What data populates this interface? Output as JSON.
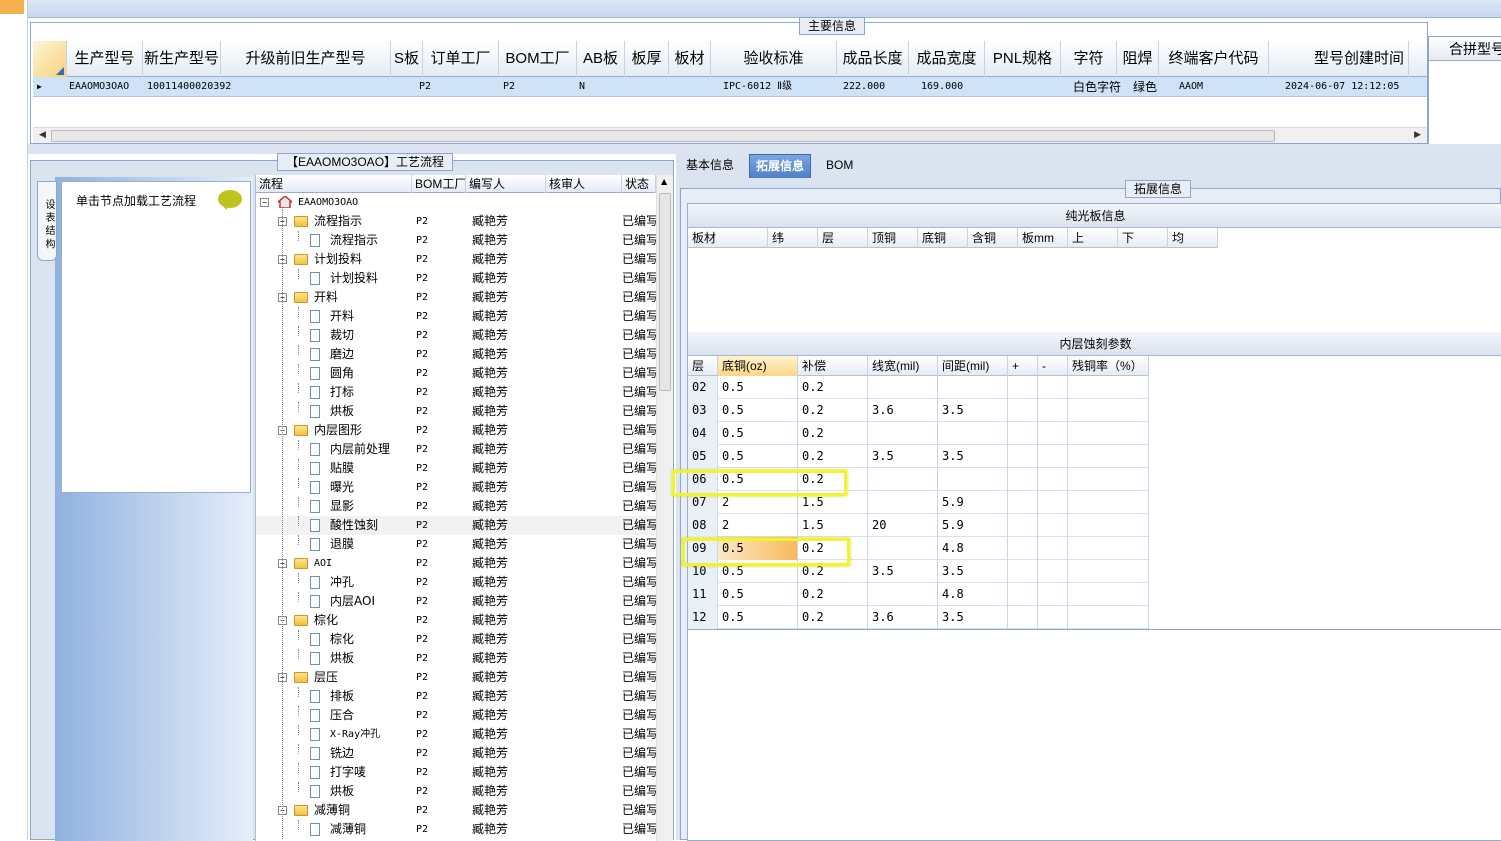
{
  "main_info": {
    "title": "主要信息",
    "columns": [
      "生产型号",
      "新生产型号",
      "升级前旧生产型号",
      "S板",
      "订单工厂",
      "BOM工厂",
      "AB板",
      "板厚",
      "板材",
      "验收标准",
      "成品长度",
      "成品宽度",
      "PNL规格",
      "字符",
      "阻焊",
      "终端客户代码",
      "型号创建时间"
    ],
    "row": {
      "model": "EAAOMO3OAO",
      "new_model": "10011400020392",
      "old_model": "",
      "s_board": "",
      "order_factory": "P2",
      "bom_factory": "P2",
      "ab_board": "N",
      "thickness": "",
      "material": "",
      "standard": "IPC-6012 Ⅱ级",
      "length": "222.000",
      "width": "169.000",
      "pnl": "",
      "char": "白色字符",
      "solder": "绿色",
      "customer": "AAOM",
      "created": "2024-06-07 12:12:05"
    },
    "merge_header": "合拼型号"
  },
  "flow": {
    "title": "【EAAOMO3OAO】工艺流程",
    "vertical_tab": "设 表 结 构",
    "hint": "单击节点加载工艺流程",
    "columns": [
      "流程",
      "BOM工厂",
      "编写人",
      "核审人",
      "状态"
    ],
    "root": "EAAOMO3OAO",
    "nodes": [
      {
        "label": "流程指示",
        "type": "folder",
        "level": 1
      },
      {
        "label": "流程指示",
        "type": "doc",
        "level": 2
      },
      {
        "label": "计划投料",
        "type": "folder",
        "level": 1
      },
      {
        "label": "计划投料",
        "type": "doc",
        "level": 2
      },
      {
        "label": "开料",
        "type": "folder",
        "level": 1
      },
      {
        "label": "开料",
        "type": "doc",
        "level": 2
      },
      {
        "label": "裁切",
        "type": "doc",
        "level": 2
      },
      {
        "label": "磨边",
        "type": "doc",
        "level": 2
      },
      {
        "label": "圆角",
        "type": "doc",
        "level": 2
      },
      {
        "label": "打标",
        "type": "doc",
        "level": 2
      },
      {
        "label": "烘板",
        "type": "doc",
        "level": 2
      },
      {
        "label": "内层图形",
        "type": "folder",
        "level": 1
      },
      {
        "label": "内层前处理",
        "type": "doc",
        "level": 2
      },
      {
        "label": "贴膜",
        "type": "doc",
        "level": 2
      },
      {
        "label": "曝光",
        "type": "doc",
        "level": 2
      },
      {
        "label": "显影",
        "type": "doc",
        "level": 2
      },
      {
        "label": "酸性蚀刻",
        "type": "doc",
        "level": 2,
        "selected": true
      },
      {
        "label": "退膜",
        "type": "doc",
        "level": 2
      },
      {
        "label": "AOI",
        "type": "folder",
        "level": 1
      },
      {
        "label": "冲孔",
        "type": "doc",
        "level": 2
      },
      {
        "label": "内层AOI",
        "type": "doc",
        "level": 2
      },
      {
        "label": "棕化",
        "type": "folder",
        "level": 1
      },
      {
        "label": "棕化",
        "type": "doc",
        "level": 2
      },
      {
        "label": "烘板",
        "type": "doc",
        "level": 2
      },
      {
        "label": "层压",
        "type": "folder",
        "level": 1
      },
      {
        "label": "排板",
        "type": "doc",
        "level": 2
      },
      {
        "label": "压合",
        "type": "doc",
        "level": 2
      },
      {
        "label": "X-Ray冲孔",
        "type": "doc",
        "level": 2
      },
      {
        "label": "铣边",
        "type": "doc",
        "level": 2
      },
      {
        "label": "打字唛",
        "type": "doc",
        "level": 2
      },
      {
        "label": "烘板",
        "type": "doc",
        "level": 2
      },
      {
        "label": "减薄铜",
        "type": "folder",
        "level": 1
      },
      {
        "label": "减薄铜",
        "type": "doc",
        "level": 2
      }
    ],
    "bom_factory": "P2",
    "writer": "臧艳芳",
    "status": "已编写"
  },
  "tabs": [
    "基本信息",
    "拓展信息",
    "BOM"
  ],
  "active_tab": 1,
  "ext": {
    "title": "拓展信息",
    "plain_board": {
      "title": "纯光板信息",
      "columns": [
        "板材",
        "纬",
        "层",
        "顶铜",
        "底铜",
        "含铜",
        "板mm",
        "上",
        "下",
        "均"
      ]
    },
    "inner_etch": {
      "title": "内层蚀刻参数",
      "columns": [
        "层",
        "底铜(oz)",
        "补偿",
        "线宽(mil)",
        "间距(mil)",
        "+",
        "-",
        "残铜率（%）"
      ],
      "rows": [
        [
          "02",
          "0.5",
          "0.2",
          "",
          "",
          "",
          "",
          ""
        ],
        [
          "03",
          "0.5",
          "0.2",
          "3.6",
          "3.5",
          "",
          "",
          ""
        ],
        [
          "04",
          "0.5",
          "0.2",
          "",
          "",
          "",
          "",
          ""
        ],
        [
          "05",
          "0.5",
          "0.2",
          "3.5",
          "3.5",
          "",
          "",
          ""
        ],
        [
          "06",
          "0.5",
          "0.2",
          "",
          "",
          "",
          "",
          ""
        ],
        [
          "07",
          "2",
          "1.5",
          "",
          "5.9",
          "",
          "",
          ""
        ],
        [
          "08",
          "2",
          "1.5",
          "20",
          "5.9",
          "",
          "",
          ""
        ],
        [
          "09",
          "0.5",
          "0.2",
          "",
          "4.8",
          "",
          "",
          ""
        ],
        [
          "10",
          "0.5",
          "0.2",
          "3.5",
          "3.5",
          "",
          "",
          ""
        ],
        [
          "11",
          "0.5",
          "0.2",
          "",
          "4.8",
          "",
          "",
          ""
        ],
        [
          "12",
          "0.5",
          "0.2",
          "3.6",
          "3.5",
          "",
          "",
          ""
        ]
      ]
    }
  },
  "colors": {
    "highlight": "#f2f230",
    "selection": "#cfe2f7",
    "active_tab": "#4f7fc9"
  }
}
